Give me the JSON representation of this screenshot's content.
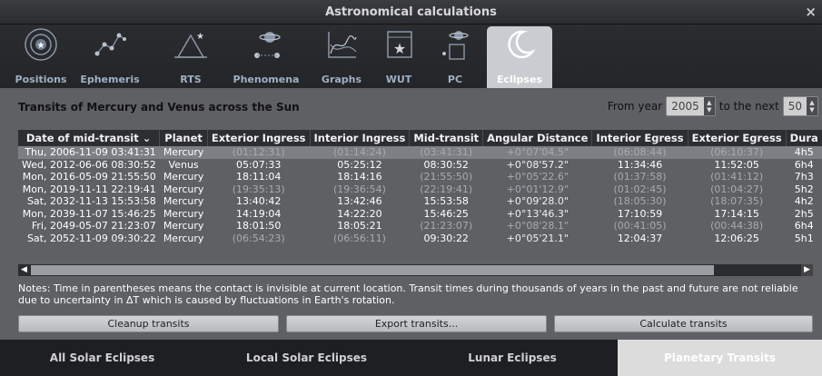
{
  "window": {
    "title": "Astronomical calculations",
    "close_icon": "×"
  },
  "tabs": [
    {
      "label": "Positions",
      "icon": "target-icon"
    },
    {
      "label": "Ephemeris",
      "icon": "constellation-icon"
    },
    {
      "label": "RTS",
      "icon": "rise-set-icon"
    },
    {
      "label": "Phenomena",
      "icon": "planets-icon"
    },
    {
      "label": "Graphs",
      "icon": "graph-icon"
    },
    {
      "label": "WUT",
      "icon": "calendar-star-icon"
    },
    {
      "label": "PC",
      "icon": "planet-calc-icon"
    },
    {
      "label": "Eclipses",
      "icon": "crescent-icon",
      "active": true
    }
  ],
  "panel": {
    "heading": "Transits of Mercury and Venus across the Sun",
    "from_year_label": "From year",
    "from_year_value": "2005",
    "next_label": "to the next",
    "next_value": "50"
  },
  "table": {
    "columns": [
      "Date of mid-transit",
      "Planet",
      "Exterior Ingress",
      "Interior Ingress",
      "Mid-transit",
      "Angular Distance",
      "Interior Egress",
      "Exterior Egress",
      "Dura"
    ],
    "rows": [
      {
        "date": "Thu, 2006-11-09 03:41:31",
        "planet": "Mercury",
        "ext_in": "(01:12:31)",
        "int_in": "(01:14:24)",
        "mid": "(03:41:31)",
        "ang": "+0°07'04.5\"",
        "int_eg": "(06:08:44)",
        "ext_eg": "(06:10:37)",
        "dur": "4h5"
      },
      {
        "date": "Wed, 2012-06-06 08:30:52",
        "planet": "Venus",
        "ext_in": "05:07:33",
        "int_in": "05:25:12",
        "mid": "08:30:52",
        "ang": "+0°08'57.2\"",
        "int_eg": "11:34:46",
        "ext_eg": "11:52:05",
        "dur": "6h4"
      },
      {
        "date": "Mon, 2016-05-09 21:55:50",
        "planet": "Mercury",
        "ext_in": "18:11:04",
        "int_in": "18:14:16",
        "mid": "(21:55:50)",
        "ang": "+0°05'22.6\"",
        "int_eg": "(01:37:58)",
        "ext_eg": "(01:41:12)",
        "dur": "7h3"
      },
      {
        "date": "Mon, 2019-11-11 22:19:41",
        "planet": "Mercury",
        "ext_in": "(19:35:13)",
        "int_in": "(19:36:54)",
        "mid": "(22:19:41)",
        "ang": "+0°01'12.9\"",
        "int_eg": "(01:02:45)",
        "ext_eg": "(01:04:27)",
        "dur": "5h2"
      },
      {
        "date": "Sat, 2032-11-13 15:53:58",
        "planet": "Mercury",
        "ext_in": "13:40:42",
        "int_in": "13:42:46",
        "mid": "15:53:58",
        "ang": "+0°09'28.0\"",
        "int_eg": "(18:05:30)",
        "ext_eg": "(18:07:35)",
        "dur": "4h2"
      },
      {
        "date": "Mon, 2039-11-07 15:46:25",
        "planet": "Mercury",
        "ext_in": "14:19:04",
        "int_in": "14:22:20",
        "mid": "15:46:25",
        "ang": "+0°13'46.3\"",
        "int_eg": "17:10:59",
        "ext_eg": "17:14:15",
        "dur": "2h5"
      },
      {
        "date": "Fri, 2049-05-07 21:23:07",
        "planet": "Mercury",
        "ext_in": "18:01:50",
        "int_in": "18:05:21",
        "mid": "(21:23:07)",
        "ang": "+0°08'28.1\"",
        "int_eg": "(00:41:05)",
        "ext_eg": "(00:44:38)",
        "dur": "6h4"
      },
      {
        "date": "Sat, 2052-11-09 09:30:22",
        "planet": "Mercury",
        "ext_in": "(06:54:23)",
        "int_in": "(06:56:11)",
        "mid": "09:30:22",
        "ang": "+0°05'21.1\"",
        "int_eg": "12:04:37",
        "ext_eg": "12:06:25",
        "dur": "5h1"
      }
    ]
  },
  "notes": "Notes: Time in parentheses means the contact is invisible at current location. Transit times during thousands of years in the past and future are not reliable due to uncertainty in ΔT which is caused by fluctuations in Earth's rotation.",
  "buttons": {
    "cleanup": "Cleanup transits",
    "export": "Export transits...",
    "calculate": "Calculate transits"
  },
  "bottom_tabs": [
    {
      "label": "All Solar Eclipses"
    },
    {
      "label": "Local Solar Eclipses"
    },
    {
      "label": "Lunar Eclipses"
    },
    {
      "label": "Planetary Transits",
      "active": true
    }
  ]
}
